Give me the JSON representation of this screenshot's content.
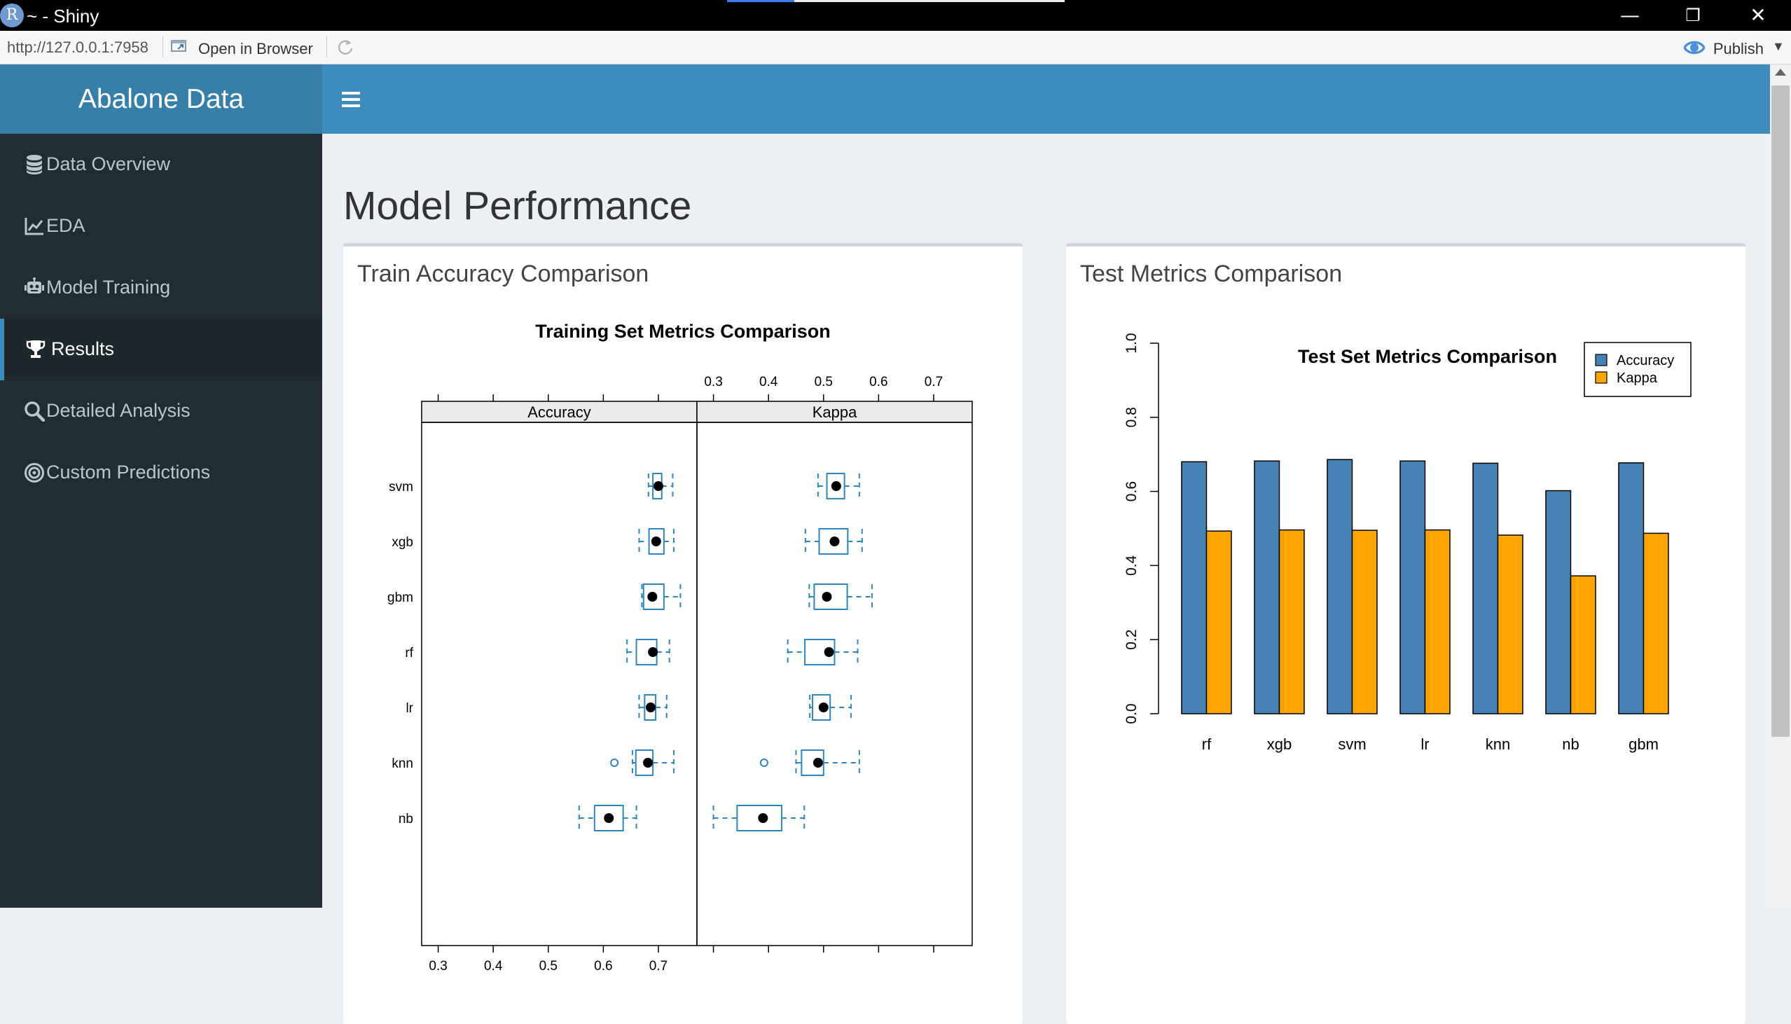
{
  "window": {
    "title": "~ - Shiny",
    "app_icon_letter": "R",
    "minimize_glyph": "—",
    "restore_glyph": "❐",
    "close_glyph": "✕"
  },
  "viewer": {
    "url": "http://127.0.0.1:7958",
    "open_in_browser": "Open in Browser",
    "publish": "Publish"
  },
  "app": {
    "brand": "Abalone Data",
    "sidebar": [
      {
        "label": "Data Overview",
        "icon": "database-icon",
        "active": false
      },
      {
        "label": "EDA",
        "icon": "line-chart-icon",
        "active": false
      },
      {
        "label": "Model Training",
        "icon": "robot-icon",
        "active": false
      },
      {
        "label": "Results",
        "icon": "trophy-icon",
        "active": true
      },
      {
        "label": "Detailed Analysis",
        "icon": "search-icon",
        "active": false
      },
      {
        "label": "Custom Predictions",
        "icon": "bullseye-icon",
        "active": false
      }
    ],
    "page_title": "Model Performance",
    "boxes": {
      "train_title": "Train Accuracy Comparison",
      "test_title": "Test Metrics Comparison"
    }
  },
  "colors": {
    "header": "#3c8dbc",
    "logo": "#367fa9",
    "sidebar": "#222d32",
    "sidebar_active": "#1e282c",
    "accuracy": "#4682b4",
    "kappa": "#ffa500",
    "box_stroke": "#2e86c1"
  },
  "chart_data": [
    {
      "type": "boxplot",
      "title": "Training Set Metrics Comparison",
      "panels": [
        "Accuracy",
        "Kappa"
      ],
      "models": [
        "svm",
        "xgb",
        "gbm",
        "rf",
        "lr",
        "knn",
        "nb"
      ],
      "xlim": [
        0.27,
        0.77
      ],
      "ticks": [
        0.3,
        0.4,
        0.5,
        0.6,
        0.7
      ],
      "tick_labels": [
        "0.3",
        "0.4",
        "0.5",
        "0.6",
        "0.7"
      ],
      "stats": {
        "Accuracy": [
          {
            "model": "svm",
            "min": 0.682,
            "q1": 0.69,
            "median": 0.7,
            "q3": 0.706,
            "max": 0.726,
            "outliers": []
          },
          {
            "model": "xgb",
            "min": 0.665,
            "q1": 0.683,
            "median": 0.696,
            "q3": 0.71,
            "max": 0.728,
            "outliers": []
          },
          {
            "model": "gbm",
            "min": 0.67,
            "q1": 0.673,
            "median": 0.689,
            "q3": 0.71,
            "max": 0.74,
            "outliers": []
          },
          {
            "model": "rf",
            "min": 0.643,
            "q1": 0.66,
            "median": 0.69,
            "q3": 0.697,
            "max": 0.72,
            "outliers": []
          },
          {
            "model": "lr",
            "min": 0.665,
            "q1": 0.675,
            "median": 0.686,
            "q3": 0.695,
            "max": 0.715,
            "outliers": []
          },
          {
            "model": "knn",
            "min": 0.653,
            "q1": 0.659,
            "median": 0.681,
            "q3": 0.69,
            "max": 0.728,
            "outliers": [
              0.62
            ]
          },
          {
            "model": "nb",
            "min": 0.556,
            "q1": 0.584,
            "median": 0.61,
            "q3": 0.636,
            "max": 0.66,
            "outliers": []
          }
        ],
        "Kappa": [
          {
            "model": "svm",
            "min": 0.49,
            "q1": 0.506,
            "median": 0.523,
            "q3": 0.538,
            "max": 0.565,
            "outliers": []
          },
          {
            "model": "xgb",
            "min": 0.467,
            "q1": 0.492,
            "median": 0.52,
            "q3": 0.544,
            "max": 0.57,
            "outliers": []
          },
          {
            "model": "gbm",
            "min": 0.474,
            "q1": 0.483,
            "median": 0.506,
            "q3": 0.543,
            "max": 0.588,
            "outliers": []
          },
          {
            "model": "rf",
            "min": 0.435,
            "q1": 0.466,
            "median": 0.51,
            "q3": 0.52,
            "max": 0.562,
            "outliers": []
          },
          {
            "model": "lr",
            "min": 0.475,
            "q1": 0.48,
            "median": 0.5,
            "q3": 0.512,
            "max": 0.55,
            "outliers": []
          },
          {
            "model": "knn",
            "min": 0.45,
            "q1": 0.46,
            "median": 0.49,
            "q3": 0.5,
            "max": 0.565,
            "outliers": [
              0.392
            ]
          },
          {
            "model": "nb",
            "min": 0.3,
            "q1": 0.343,
            "median": 0.39,
            "q3": 0.424,
            "max": 0.465,
            "outliers": []
          }
        ]
      }
    },
    {
      "type": "bar",
      "title": "Test Set Metrics Comparison",
      "categories": [
        "rf",
        "xgb",
        "svm",
        "lr",
        "knn",
        "nb",
        "gbm"
      ],
      "series": [
        {
          "name": "Accuracy",
          "values": [
            0.68,
            0.682,
            0.686,
            0.682,
            0.676,
            0.602,
            0.677
          ]
        },
        {
          "name": "Kappa",
          "values": [
            0.493,
            0.496,
            0.495,
            0.496,
            0.482,
            0.372,
            0.487
          ]
        }
      ],
      "ylim": [
        0,
        1
      ],
      "yticks": [
        0,
        0.2,
        0.4,
        0.6,
        0.8,
        1.0
      ],
      "ytick_labels": [
        "0.0",
        "0.2",
        "0.4",
        "0.6",
        "0.8",
        "1.0"
      ],
      "legend_position": "top-right"
    }
  ]
}
